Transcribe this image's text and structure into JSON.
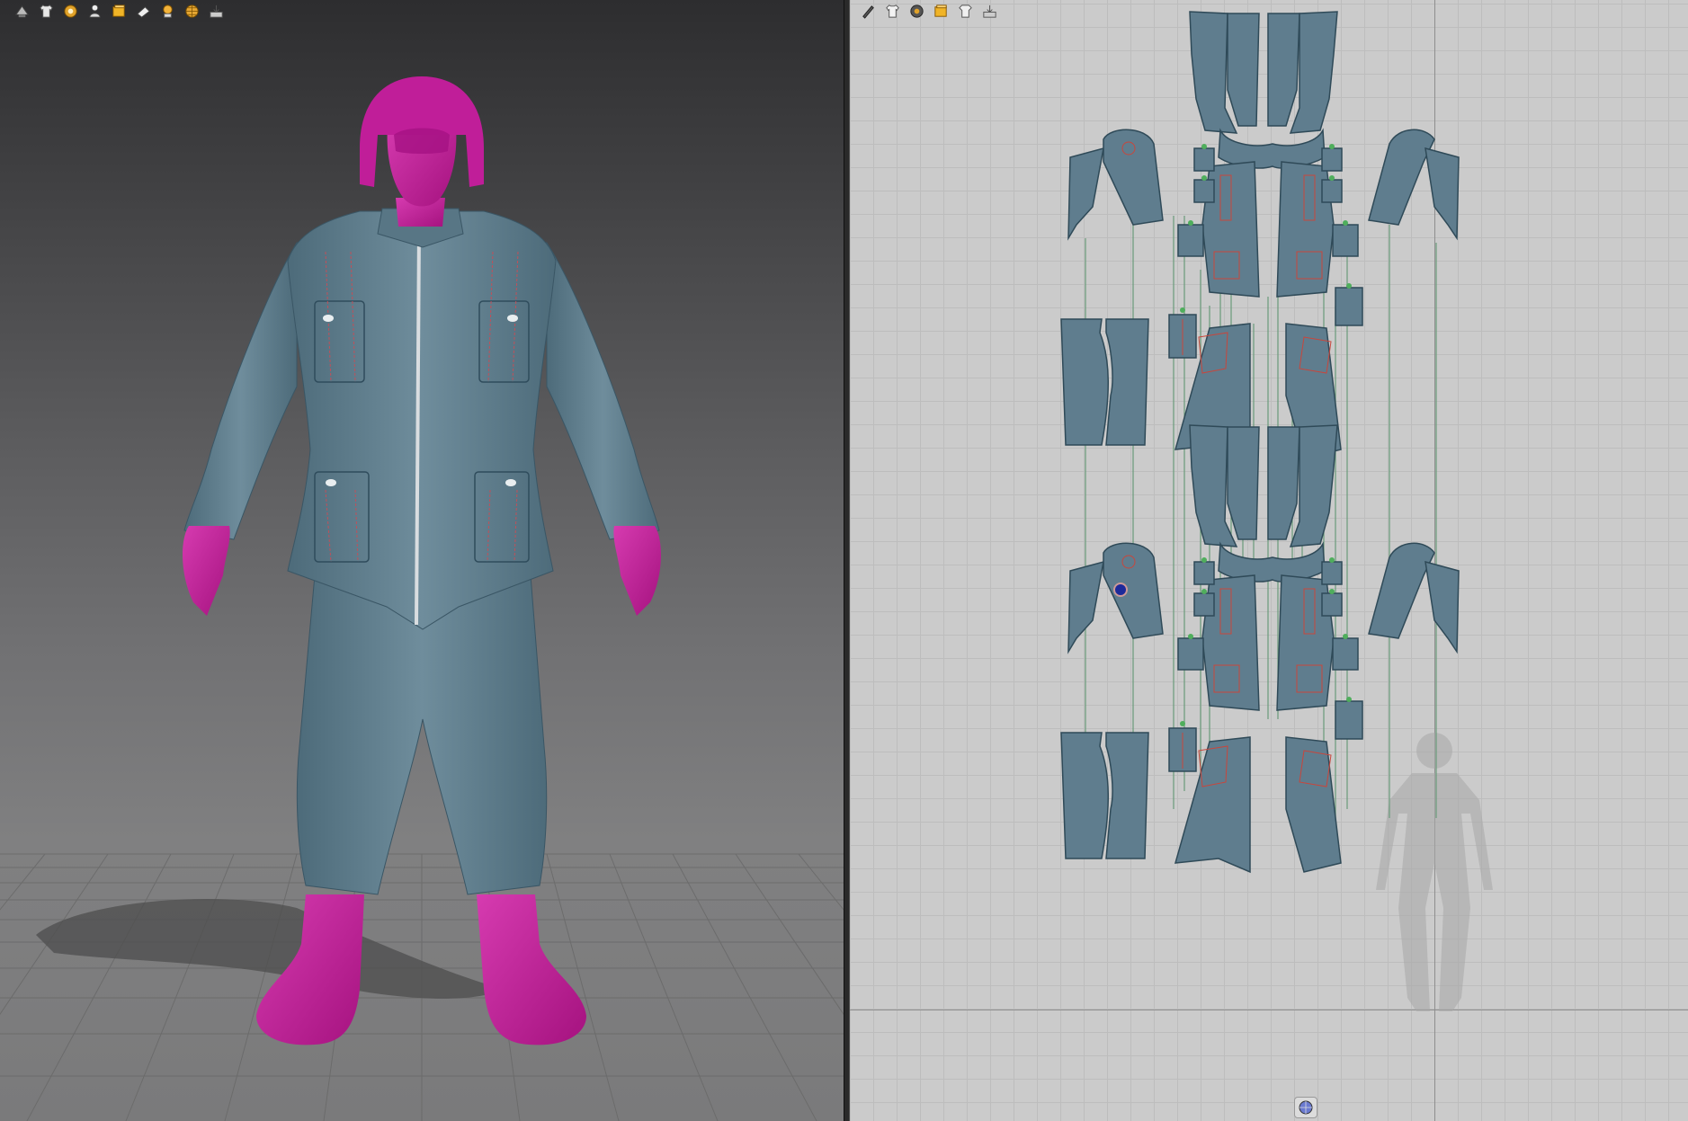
{
  "app": {
    "left_view": "3d-viewport",
    "right_view": "2d-pattern-window"
  },
  "toolbar_3d": {
    "icons": [
      "display-avatar-icon",
      "display-garment-icon",
      "toggle-pins-icon",
      "show-avatar-icon",
      "texture-icon",
      "flat-shading-icon",
      "light-icon",
      "world-grid-icon",
      "save-icon"
    ]
  },
  "toolbar_2d": {
    "icons": [
      "pen-icon",
      "show-pattern-icon",
      "sewing-lines-icon",
      "texture-2d-icon",
      "arrange-icon",
      "save-2d-icon"
    ]
  },
  "colors": {
    "fabric": "#5c7a8a",
    "fabric_outline": "#2e4a5a",
    "avatar": "#c91e9e",
    "stitch": "#d2403a",
    "sewing_line": "#5f8f6f",
    "background_2d": "#cbcbcb"
  }
}
